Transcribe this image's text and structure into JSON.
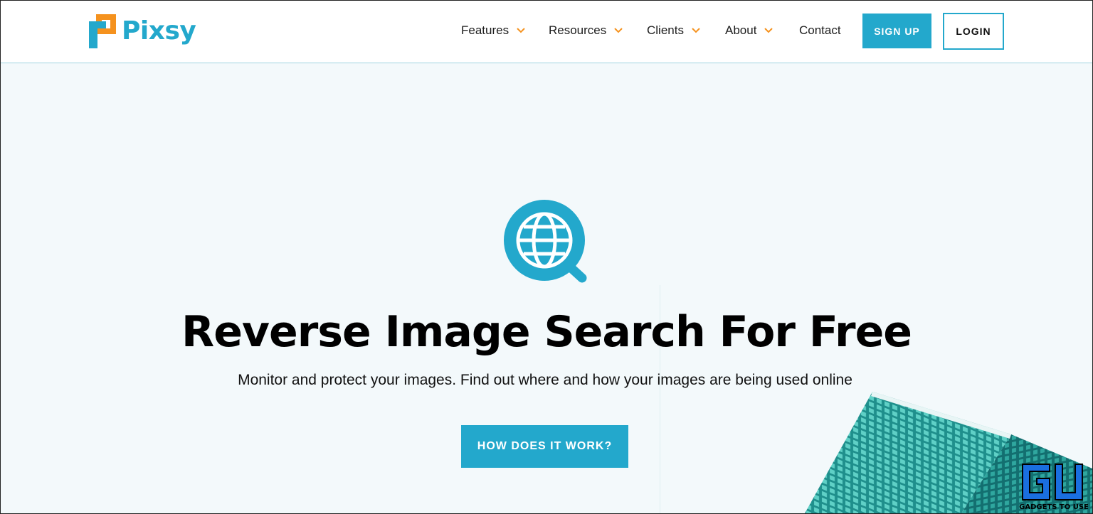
{
  "brand": {
    "name": "Pixsy"
  },
  "nav": {
    "items": [
      {
        "label": "Features",
        "has_dropdown": true
      },
      {
        "label": "Resources",
        "has_dropdown": true
      },
      {
        "label": "Clients",
        "has_dropdown": true
      },
      {
        "label": "About",
        "has_dropdown": true
      },
      {
        "label": "Contact",
        "has_dropdown": false
      }
    ],
    "signup_label": "SIGN UP",
    "login_label": "LOGIN"
  },
  "hero": {
    "icon": "globe-search-icon",
    "title": "Reverse Image Search For Free",
    "subtitle": "Monitor and protect your images. Find out where and how your images are being used online",
    "cta_label": "HOW DOES IT WORK?"
  },
  "watermark": {
    "text": "GADGETS TO USE"
  },
  "colors": {
    "accent": "#23a8cc",
    "logo_orange": "#f5921e",
    "chevron": "#f5921e",
    "hero_bg": "#f3f9fb"
  }
}
